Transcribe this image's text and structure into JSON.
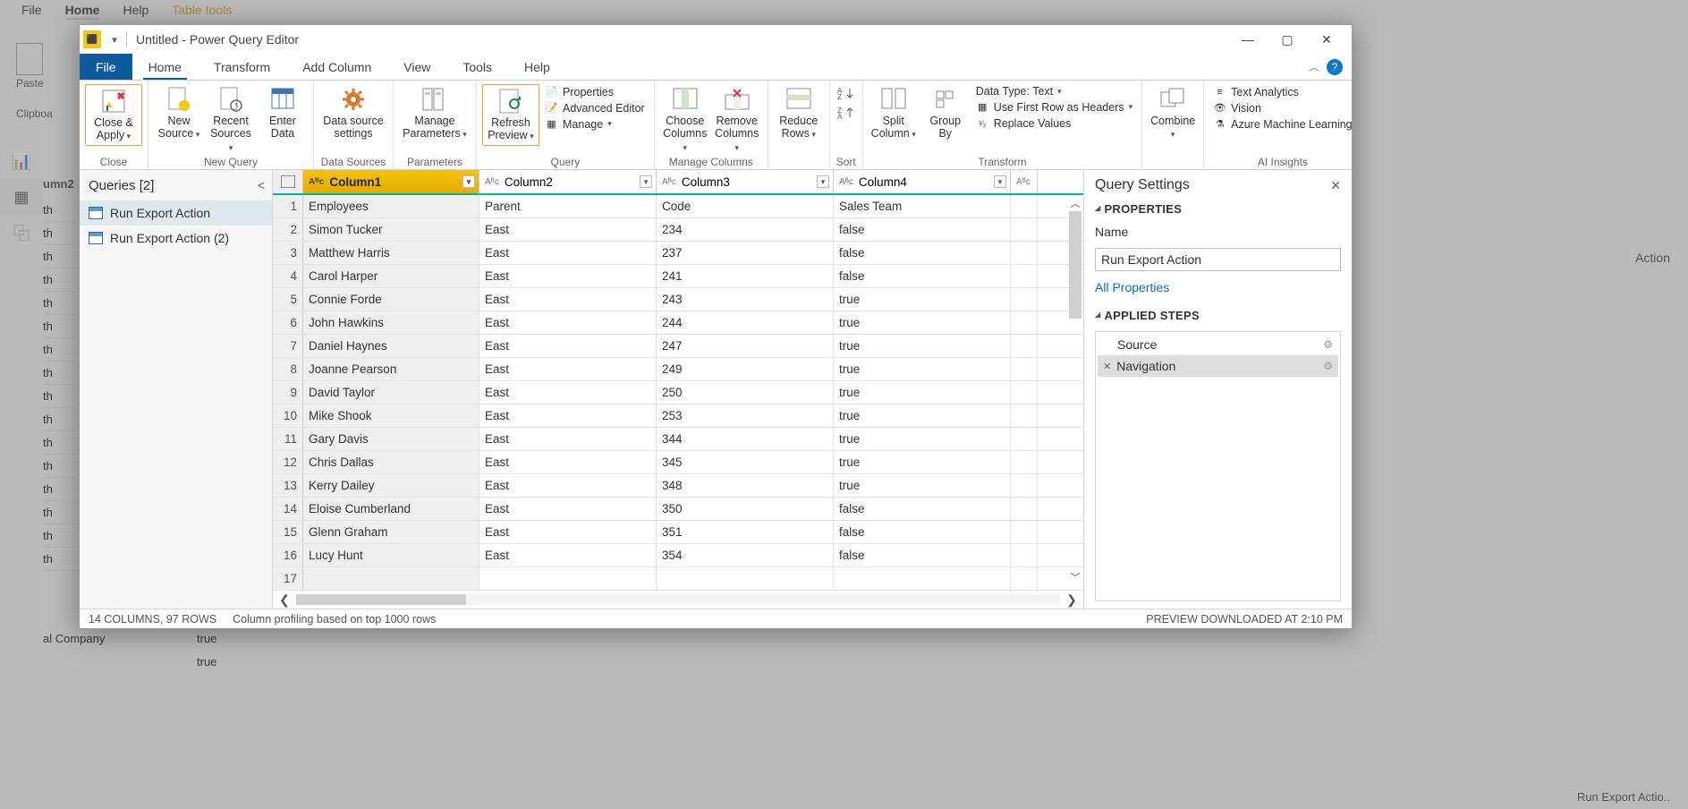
{
  "bg": {
    "menu": [
      "File",
      "Home",
      "Help",
      "Table tools"
    ],
    "paste": "Paste",
    "clipboard": "Clipboa",
    "right_action": "Action",
    "right_footer": "Run Export Actio..",
    "left_frag1": "umn2",
    "left_frag_th": "th",
    "bal_company": "al Company",
    "true": "true"
  },
  "pq": {
    "title": "Untitled - Power Query Editor",
    "tabs": [
      "File",
      "Home",
      "Transform",
      "Add Column",
      "View",
      "Tools",
      "Help"
    ],
    "ribbon": {
      "close_apply": "Close & Apply",
      "close_group": "Close",
      "new_source": "New Source",
      "recent_sources": "Recent Sources",
      "enter_data": "Enter Data",
      "new_query": "New Query",
      "data_source_settings": "Data source settings",
      "data_sources": "Data Sources",
      "manage_parameters": "Manage Parameters",
      "parameters": "Parameters",
      "refresh_preview": "Refresh Preview",
      "properties": "Properties",
      "advanced_editor": "Advanced Editor",
      "manage": "Manage",
      "query": "Query",
      "choose_columns": "Choose Columns",
      "remove_columns": "Remove Columns",
      "manage_columns": "Manage Columns",
      "reduce_rows": "Reduce Rows",
      "sort": "Sort",
      "split_column": "Split Column",
      "group_by": "Group By",
      "data_type": "Data Type: Text",
      "use_first_row": "Use First Row as Headers",
      "replace_values": "Replace Values",
      "transform": "Transform",
      "combine": "Combine",
      "text_analytics": "Text Analytics",
      "vision": "Vision",
      "azure_ml": "Azure Machine Learning",
      "ai_insights": "AI Insights"
    },
    "queries": {
      "header": "Queries [2]",
      "items": [
        "Run Export Action",
        "Run Export Action (2)"
      ]
    },
    "columns": [
      "Column1",
      "Column2",
      "Column3",
      "Column4"
    ],
    "rows": [
      {
        "n": 1,
        "c": [
          "Employees",
          "Parent",
          "Code",
          "Sales Team"
        ]
      },
      {
        "n": 2,
        "c": [
          "Simon Tucker",
          "East",
          "234",
          "false"
        ]
      },
      {
        "n": 3,
        "c": [
          "Matthew Harris",
          "East",
          "237",
          "false"
        ]
      },
      {
        "n": 4,
        "c": [
          "Carol Harper",
          "East",
          "241",
          "false"
        ]
      },
      {
        "n": 5,
        "c": [
          "Connie Forde",
          "East",
          "243",
          "true"
        ]
      },
      {
        "n": 6,
        "c": [
          "John Hawkins",
          "East",
          "244",
          "true"
        ]
      },
      {
        "n": 7,
        "c": [
          "Daniel Haynes",
          "East",
          "247",
          "true"
        ]
      },
      {
        "n": 8,
        "c": [
          "Joanne Pearson",
          "East",
          "249",
          "true"
        ]
      },
      {
        "n": 9,
        "c": [
          "David Taylor",
          "East",
          "250",
          "true"
        ]
      },
      {
        "n": 10,
        "c": [
          "Mike Shook",
          "East",
          "253",
          "true"
        ]
      },
      {
        "n": 11,
        "c": [
          "Gary Davis",
          "East",
          "344",
          "true"
        ]
      },
      {
        "n": 12,
        "c": [
          "Chris Dallas",
          "East",
          "345",
          "true"
        ]
      },
      {
        "n": 13,
        "c": [
          "Kerry Dailey",
          "East",
          "348",
          "true"
        ]
      },
      {
        "n": 14,
        "c": [
          "Eloise Cumberland",
          "East",
          "350",
          "false"
        ]
      },
      {
        "n": 15,
        "c": [
          "Glenn Graham",
          "East",
          "351",
          "false"
        ]
      },
      {
        "n": 16,
        "c": [
          "Lucy Hunt",
          "East",
          "354",
          "false"
        ]
      },
      {
        "n": 17,
        "c": [
          "",
          "",
          "",
          ""
        ]
      }
    ],
    "settings": {
      "header": "Query Settings",
      "properties": "PROPERTIES",
      "name_label": "Name",
      "name_value": "Run Export Action",
      "all_properties": "All Properties",
      "applied_steps": "APPLIED STEPS",
      "steps": [
        "Source",
        "Navigation"
      ]
    },
    "status": {
      "cols": "14 COLUMNS, 97 ROWS",
      "profiling": "Column profiling based on top 1000 rows",
      "preview": "PREVIEW DOWNLOADED AT 2:10 PM"
    }
  }
}
